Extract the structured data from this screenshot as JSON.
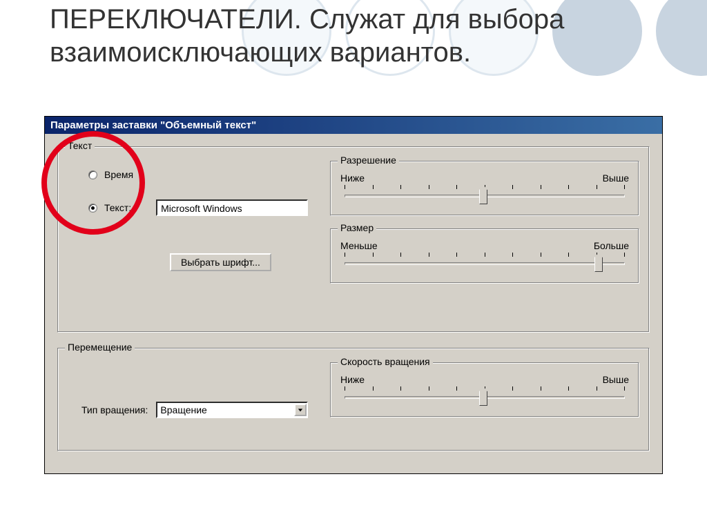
{
  "slide": {
    "title": "ПЕРЕКЛЮЧАТЕЛИ. Служат для выбора взаимоисключающих вариантов."
  },
  "dialog": {
    "title": "Параметры заставки \"Объемный текст\"",
    "group_text": {
      "legend": "Текст",
      "radio_time": "Время",
      "radio_text": "Текст:",
      "text_value": "Microsoft Windows",
      "font_button": "Выбрать шрифт..."
    },
    "group_movement": {
      "legend": "Перемещение",
      "rotation_type_label": "Тип вращения:",
      "rotation_type_value": "Вращение"
    },
    "sliders": {
      "resolution": {
        "legend": "Разрешение",
        "low": "Ниже",
        "high": "Выше"
      },
      "size": {
        "legend": "Размер",
        "low": "Меньше",
        "high": "Больше"
      },
      "speed": {
        "legend": "Скорость вращения",
        "low": "Ниже",
        "high": "Выше"
      }
    }
  }
}
